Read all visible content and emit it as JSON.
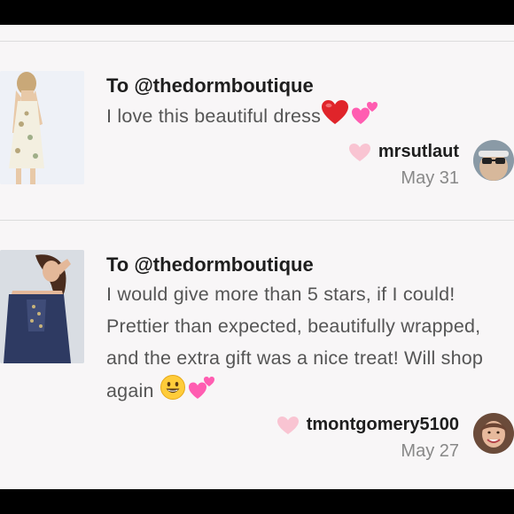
{
  "reviews": [
    {
      "to": "To @thedormboutique",
      "message": "I love this beautiful dress",
      "username": "mrsutlaut",
      "date": "May 31"
    },
    {
      "to": "To @thedormboutique",
      "message": "I would give more than 5 stars, if I could! Prettier than expected, beautifully wrapped, and the extra gift was a nice treat! Will shop again",
      "username": "tmontgomery5100",
      "date": "May 27"
    }
  ],
  "colors": {
    "like_heart": "#f9c4d2",
    "text": "#555555",
    "title": "#1e1e1e",
    "date": "#888888"
  },
  "icons": [
    "red-heart-emoji",
    "two-hearts-emoji",
    "grinning-face-emoji",
    "like-heart-icon"
  ]
}
